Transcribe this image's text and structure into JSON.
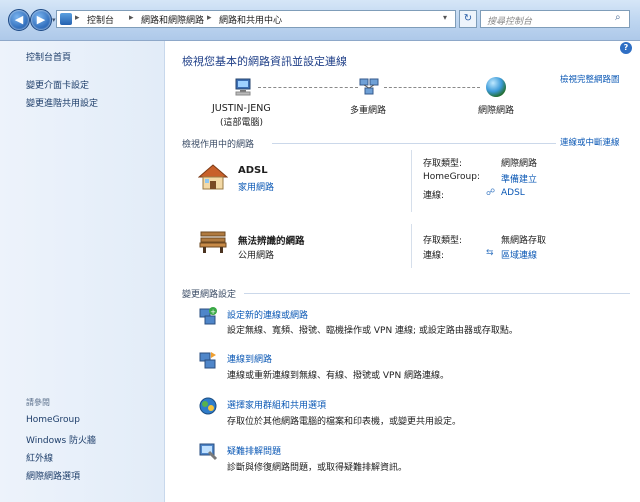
{
  "address": {
    "crumbs": [
      "控制台",
      "網路和網際網路",
      "網路和共用中心"
    ],
    "search_placeholder": "搜尋控制台"
  },
  "left": {
    "home": "控制台首頁",
    "links": [
      "變更介面卡設定",
      "變更進階共用設定"
    ],
    "see_also_title": "請參閱",
    "see_also": [
      "HomeGroup",
      "Windows 防火牆",
      "紅外線",
      "網際網路選項"
    ]
  },
  "main": {
    "title": "檢視您基本的網路資訊並設定連線",
    "view_full_map": "檢視完整網路圖",
    "map": {
      "computer": "JUSTIN-JENG",
      "computer_sub": "(這部電腦)",
      "middle": "多重網路",
      "internet": "網際網路"
    },
    "active_title": "檢視作用中的網路",
    "connect_disconnect": "連線或中斷連線",
    "networks": [
      {
        "name": "ADSL",
        "type_link": "家用網路",
        "rows": [
          {
            "label": "存取類型:",
            "value": "網際網路",
            "is_link": false
          },
          {
            "label": "HomeGroup:",
            "value": "準備建立",
            "is_link": true
          },
          {
            "label": "連線:",
            "value": "ADSL",
            "is_link": true
          }
        ]
      },
      {
        "name": "無法辨識的網路",
        "type_text": "公用網路",
        "rows": [
          {
            "label": "存取類型:",
            "value": "無網路存取",
            "is_link": false
          },
          {
            "label": "連線:",
            "value": "區域連線",
            "is_link": true
          }
        ]
      }
    ],
    "change_title": "變更網路設定",
    "tasks": [
      {
        "title": "設定新的連線或網路",
        "desc": "設定無線、寬頻、撥號、臨機操作或 VPN 連線; 或設定路由器或存取點。"
      },
      {
        "title": "連線到網路",
        "desc": "連線或重新連線到無線、有線、撥號或 VPN 網路連線。"
      },
      {
        "title": "選擇家用群組和共用選項",
        "desc": "存取位於其他網路電腦的檔案和印表機，或變更共用設定。"
      },
      {
        "title": "疑難排解問題",
        "desc": "診斷與修復網路問題，或取得疑難排解資訊。"
      }
    ]
  },
  "colors": {
    "link": "#0b58b5",
    "heading": "#1e3e87",
    "leftpane": "#e2ecf8"
  }
}
